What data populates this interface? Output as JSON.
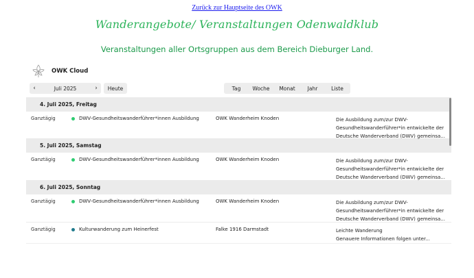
{
  "back_link": "Zurück zur Hauptseite des OWK",
  "title": "Wanderangebote/ Veranstaltungen Odenwaldklub",
  "subtitle": "Veranstaltungen aller Ortsgruppen aus dem Bereich Dieburger Land.",
  "cloud": {
    "title": "OWK Cloud",
    "logo_icon": "leaf-logo-icon"
  },
  "toolbar": {
    "prev": "‹",
    "month": "Juli 2025",
    "next": "›",
    "today": "Heute",
    "views": [
      "Tag",
      "Woche",
      "Monat",
      "Jahr",
      "Liste"
    ]
  },
  "colors": {
    "green": "#2ecc71",
    "teal": "#1f7a8c"
  },
  "days": [
    {
      "header": "4. Juli 2025, Freitag",
      "events": [
        {
          "time": "Ganztägig",
          "title": "DWV-Gesundheitswanderführer*innen Ausbildung",
          "location": "OWK Wanderheim Knoden",
          "desc_lines": [
            "Die Ausbildung zum/zur DWV-",
            "Gesundheitswanderführer*in entwickelte der",
            "Deutsche Wanderverband (DWV) gemeinsa..."
          ],
          "dot": "#2ecc71"
        }
      ]
    },
    {
      "header": "5. Juli 2025, Samstag",
      "events": [
        {
          "time": "Ganztägig",
          "title": "DWV-Gesundheitswanderführer*innen Ausbildung",
          "location": "OWK Wanderheim Knoden",
          "desc_lines": [
            "Die Ausbildung zum/zur DWV-",
            "Gesundheitswanderführer*in entwickelte der",
            "Deutsche Wanderverband (DWV) gemeinsa..."
          ],
          "dot": "#2ecc71"
        }
      ]
    },
    {
      "header": "6. Juli 2025, Sonntag",
      "events": [
        {
          "time": "Ganztägig",
          "title": "DWV-Gesundheitswanderführer*innen Ausbildung",
          "location": "OWK Wanderheim Knoden",
          "desc_lines": [
            "Die Ausbildung zum/zur DWV-",
            "Gesundheitswanderführer*in entwickelte der",
            "Deutsche Wanderverband (DWV) gemeinsa..."
          ],
          "dot": "#2ecc71"
        },
        {
          "time": "Ganztägig",
          "title": "Kulturwanderung zum Heinerfest",
          "location": "Falke 1916 Darmstadt",
          "desc_lines": [
            "Leichte Wanderung",
            "",
            "Genauere Informationen folgen unter..."
          ],
          "dot": "#1f7a8c"
        }
      ]
    }
  ]
}
